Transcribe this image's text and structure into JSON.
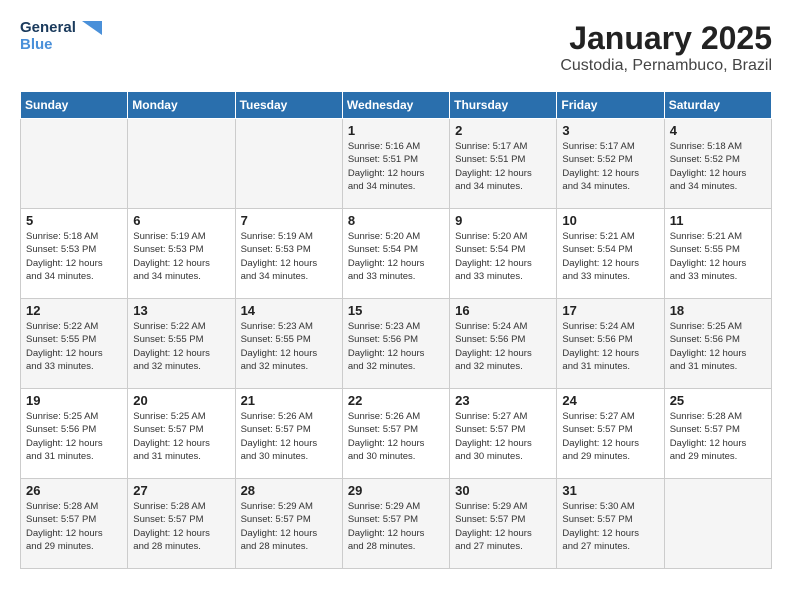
{
  "header": {
    "logo": {
      "line1": "General",
      "line2": "Blue"
    },
    "title": "January 2025",
    "subtitle": "Custodia, Pernambuco, Brazil"
  },
  "weekdays": [
    "Sunday",
    "Monday",
    "Tuesday",
    "Wednesday",
    "Thursday",
    "Friday",
    "Saturday"
  ],
  "weeks": [
    [
      {
        "day": "",
        "info": ""
      },
      {
        "day": "",
        "info": ""
      },
      {
        "day": "",
        "info": ""
      },
      {
        "day": "1",
        "info": "Sunrise: 5:16 AM\nSunset: 5:51 PM\nDaylight: 12 hours\nand 34 minutes."
      },
      {
        "day": "2",
        "info": "Sunrise: 5:17 AM\nSunset: 5:51 PM\nDaylight: 12 hours\nand 34 minutes."
      },
      {
        "day": "3",
        "info": "Sunrise: 5:17 AM\nSunset: 5:52 PM\nDaylight: 12 hours\nand 34 minutes."
      },
      {
        "day": "4",
        "info": "Sunrise: 5:18 AM\nSunset: 5:52 PM\nDaylight: 12 hours\nand 34 minutes."
      }
    ],
    [
      {
        "day": "5",
        "info": "Sunrise: 5:18 AM\nSunset: 5:53 PM\nDaylight: 12 hours\nand 34 minutes."
      },
      {
        "day": "6",
        "info": "Sunrise: 5:19 AM\nSunset: 5:53 PM\nDaylight: 12 hours\nand 34 minutes."
      },
      {
        "day": "7",
        "info": "Sunrise: 5:19 AM\nSunset: 5:53 PM\nDaylight: 12 hours\nand 34 minutes."
      },
      {
        "day": "8",
        "info": "Sunrise: 5:20 AM\nSunset: 5:54 PM\nDaylight: 12 hours\nand 33 minutes."
      },
      {
        "day": "9",
        "info": "Sunrise: 5:20 AM\nSunset: 5:54 PM\nDaylight: 12 hours\nand 33 minutes."
      },
      {
        "day": "10",
        "info": "Sunrise: 5:21 AM\nSunset: 5:54 PM\nDaylight: 12 hours\nand 33 minutes."
      },
      {
        "day": "11",
        "info": "Sunrise: 5:21 AM\nSunset: 5:55 PM\nDaylight: 12 hours\nand 33 minutes."
      }
    ],
    [
      {
        "day": "12",
        "info": "Sunrise: 5:22 AM\nSunset: 5:55 PM\nDaylight: 12 hours\nand 33 minutes."
      },
      {
        "day": "13",
        "info": "Sunrise: 5:22 AM\nSunset: 5:55 PM\nDaylight: 12 hours\nand 32 minutes."
      },
      {
        "day": "14",
        "info": "Sunrise: 5:23 AM\nSunset: 5:55 PM\nDaylight: 12 hours\nand 32 minutes."
      },
      {
        "day": "15",
        "info": "Sunrise: 5:23 AM\nSunset: 5:56 PM\nDaylight: 12 hours\nand 32 minutes."
      },
      {
        "day": "16",
        "info": "Sunrise: 5:24 AM\nSunset: 5:56 PM\nDaylight: 12 hours\nand 32 minutes."
      },
      {
        "day": "17",
        "info": "Sunrise: 5:24 AM\nSunset: 5:56 PM\nDaylight: 12 hours\nand 31 minutes."
      },
      {
        "day": "18",
        "info": "Sunrise: 5:25 AM\nSunset: 5:56 PM\nDaylight: 12 hours\nand 31 minutes."
      }
    ],
    [
      {
        "day": "19",
        "info": "Sunrise: 5:25 AM\nSunset: 5:56 PM\nDaylight: 12 hours\nand 31 minutes."
      },
      {
        "day": "20",
        "info": "Sunrise: 5:25 AM\nSunset: 5:57 PM\nDaylight: 12 hours\nand 31 minutes."
      },
      {
        "day": "21",
        "info": "Sunrise: 5:26 AM\nSunset: 5:57 PM\nDaylight: 12 hours\nand 30 minutes."
      },
      {
        "day": "22",
        "info": "Sunrise: 5:26 AM\nSunset: 5:57 PM\nDaylight: 12 hours\nand 30 minutes."
      },
      {
        "day": "23",
        "info": "Sunrise: 5:27 AM\nSunset: 5:57 PM\nDaylight: 12 hours\nand 30 minutes."
      },
      {
        "day": "24",
        "info": "Sunrise: 5:27 AM\nSunset: 5:57 PM\nDaylight: 12 hours\nand 29 minutes."
      },
      {
        "day": "25",
        "info": "Sunrise: 5:28 AM\nSunset: 5:57 PM\nDaylight: 12 hours\nand 29 minutes."
      }
    ],
    [
      {
        "day": "26",
        "info": "Sunrise: 5:28 AM\nSunset: 5:57 PM\nDaylight: 12 hours\nand 29 minutes."
      },
      {
        "day": "27",
        "info": "Sunrise: 5:28 AM\nSunset: 5:57 PM\nDaylight: 12 hours\nand 28 minutes."
      },
      {
        "day": "28",
        "info": "Sunrise: 5:29 AM\nSunset: 5:57 PM\nDaylight: 12 hours\nand 28 minutes."
      },
      {
        "day": "29",
        "info": "Sunrise: 5:29 AM\nSunset: 5:57 PM\nDaylight: 12 hours\nand 28 minutes."
      },
      {
        "day": "30",
        "info": "Sunrise: 5:29 AM\nSunset: 5:57 PM\nDaylight: 12 hours\nand 27 minutes."
      },
      {
        "day": "31",
        "info": "Sunrise: 5:30 AM\nSunset: 5:57 PM\nDaylight: 12 hours\nand 27 minutes."
      },
      {
        "day": "",
        "info": ""
      }
    ]
  ]
}
